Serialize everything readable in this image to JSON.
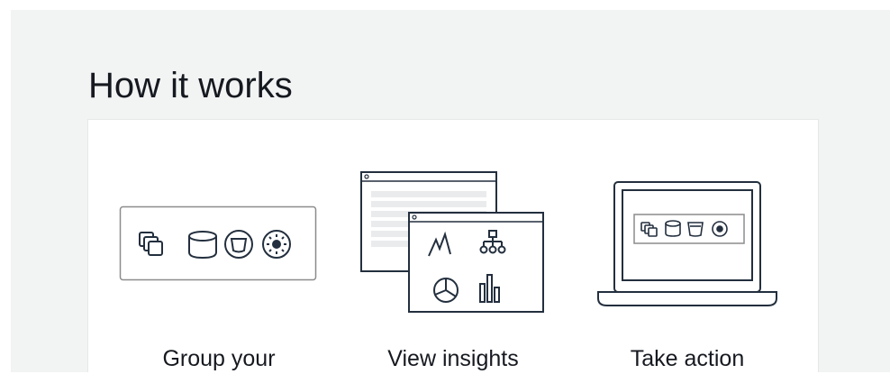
{
  "section": {
    "title": "How it works"
  },
  "steps": [
    {
      "label": "Group your",
      "illustration": "resource-group-illustration"
    },
    {
      "label": "View insights",
      "illustration": "dashboard-insights-illustration"
    },
    {
      "label": "Take action",
      "illustration": "laptop-action-illustration"
    }
  ],
  "colors": {
    "panel_background": "#f2f4f4",
    "card_background": "#ffffff",
    "text": "#16191f",
    "illustration_stroke": "#232f3e"
  }
}
